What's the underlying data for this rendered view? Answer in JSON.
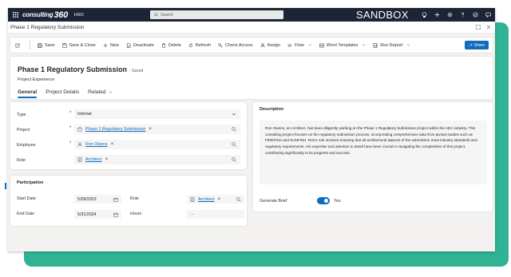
{
  "topbar": {
    "brand": "consulting",
    "brand_num": "360",
    "app_name": "HSO",
    "search_placeholder": "Search",
    "environment": "SANDBOX"
  },
  "dialog": {
    "title": "Phase 1 Regulatory Submission"
  },
  "commands": [
    {
      "label": ""
    },
    {
      "label": "Save"
    },
    {
      "label": "Save & Close"
    },
    {
      "label": "New"
    },
    {
      "label": "Deactivate"
    },
    {
      "label": "Delete"
    },
    {
      "label": "Refresh"
    },
    {
      "label": "Check Access"
    },
    {
      "label": "Assign"
    },
    {
      "label": "Flow"
    },
    {
      "label": "Word Templates"
    },
    {
      "label": "Run Report"
    }
  ],
  "share_label": "Share",
  "record": {
    "title": "Phase 1 Regulatory Submission",
    "status": "- Saved",
    "entity": "Project Experience"
  },
  "tabs": [
    {
      "label": "General"
    },
    {
      "label": "Project Details"
    },
    {
      "label": "Related"
    }
  ],
  "general": {
    "type": {
      "label": "Type",
      "value": "Internal"
    },
    "project": {
      "label": "Project",
      "value": "Phase 1 Regulatory Submission"
    },
    "employee": {
      "label": "Employee",
      "value": "Ron Owens"
    },
    "role": {
      "label": "Role",
      "value": "Architect"
    }
  },
  "participation": {
    "title": "Participation",
    "start_date": {
      "label": "Start Date",
      "value": "5/28/2023"
    },
    "end_date": {
      "label": "End Date",
      "value": "5/31/2024"
    },
    "role": {
      "label": "Role",
      "value": "Architect"
    },
    "hours": {
      "label": "Hours",
      "value": "---"
    }
  },
  "description": {
    "title": "Description",
    "text": "Ron Owens, an Architect, has been diligently working on the Phase 1 Regulatory Submission project within the AEC industry. This consulting project focuses on the regulatory submission process, incorporating comprehensive data from pivotal studies such as FIREFISH and SUNFISH. Ron's role involves ensuring that all architectural aspects of the submission meet industry standards and regulatory requirements. His expertise and attention to detail have been crucial in navigating the complexities of this project, contributing significantly to its progress and success.",
    "generate_brief_label": "Generate Brief",
    "generate_brief_value": "Yes"
  },
  "colors": {
    "accent": "#0f6cbd",
    "topbar": "#1b2535",
    "backdrop": "#2fb394"
  }
}
